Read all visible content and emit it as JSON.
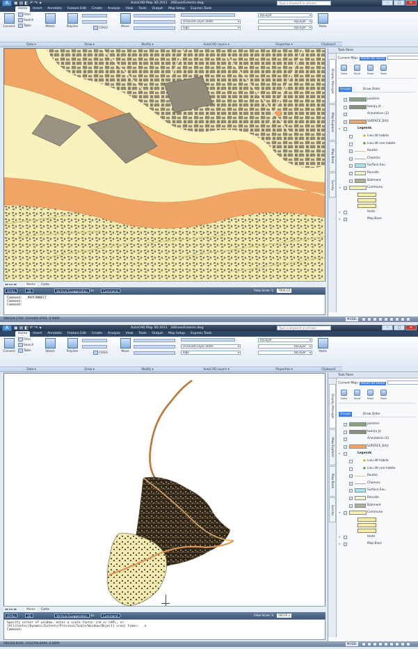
{
  "app": {
    "title": "AutoCAD Map 3D 2011",
    "drawing_name": "28ZoomExtents.dwg",
    "search_placeholder": "Type a keyword or phrase"
  },
  "ribbon": {
    "tabs": [
      "Home",
      "Insert",
      "Annotate",
      "Feature Edit",
      "Create",
      "Analyze",
      "View",
      "Tools",
      "Output",
      "Map Setup",
      "Express Tools"
    ],
    "active_tab": "Home",
    "data": {
      "connect": "Connect",
      "filter": "Filter",
      "search": "Search",
      "table": "Table",
      "attach": "Attach"
    },
    "draw": {
      "polyline": "Polyline",
      "cogo": "COGO"
    },
    "modify": {
      "move": "Move"
    },
    "autocad_layers": {
      "layer_state": "Unsaved Layer State",
      "layer": "logo"
    },
    "properties": {
      "color": "ByLayer",
      "linetype": "ByLayer",
      "lineweight": "ByLayer"
    },
    "clipboard": {
      "paste": "Paste"
    },
    "panels": [
      "Data ▾",
      "Draw ▾",
      "Modify ▾",
      "AutoCAD Layers ▾",
      "Properties ▾",
      "Clipboard"
    ]
  },
  "layout_tabs": [
    "Model",
    "Carte"
  ],
  "nav": {
    "ortho": "Ortho",
    "mode_2d": "2D",
    "vertical_exaggeration": "Vertical Exaggeration",
    "exaggeration_value": "1x",
    "command_label": "Command",
    "view_scale_label": "View Scale: 1:",
    "view_scale_top": "7904.03",
    "view_scale_bottom": "58535.2"
  },
  "command": {
    "top": [
      "Command:  _MAPCONNECT",
      "Command:",
      "Command:"
    ],
    "bottom": [
      "Specify corner of window, enter a scale factor (nX or nXP), or",
      "[All/Center/Dynamic/Extents/Previous/Scale/Window/Object] <real time>:  _e",
      "Command:"
    ]
  },
  "status": {
    "coord_top": "580329.2706, 2434465.8761, 0.0000",
    "coord_bottom": "580329.8292, 2434766.8094, 0.0000",
    "model": "MODEL"
  },
  "task_pane": {
    "title": "Task Pane",
    "current_map_label": "Current Map:",
    "current_map": "Hauts-de-Seine",
    "side_tabs": [
      "Display Manager",
      "Map Explorer",
      "Map Book",
      "Survey"
    ],
    "tools": [
      "Data",
      "Style",
      "Table",
      "Tools"
    ],
    "groups_label": "Groups",
    "draw_order_label": "Draw Order",
    "layers": [
      {
        "name": "pointers",
        "checked": true,
        "expand": "",
        "indent": 0,
        "swatch": "#8aa27e"
      },
      {
        "name": "Iwenja_tt",
        "checked": false,
        "expand": "",
        "indent": 0,
        "swatch": "#8a8e7b"
      },
      {
        "name": "Annotation (2)",
        "checked": true,
        "expand": "",
        "indent": 0,
        "swatch": "#ffffff"
      },
      {
        "name": "SURFACE_EAU",
        "checked": true,
        "expand": "",
        "indent": 0,
        "swatch": "#f0a567"
      },
      {
        "name": "Legends",
        "checked": false,
        "expand": "▸",
        "indent": 0,
        "swatch": "folder"
      },
      {
        "name": "Lieu dit habite",
        "checked": false,
        "expand": "",
        "indent": 1,
        "swatch": "dot-yellow"
      },
      {
        "name": "Lieu dit non-habite",
        "checked": false,
        "expand": "",
        "indent": 1,
        "swatch": "dot-green"
      },
      {
        "name": "Routes",
        "checked": true,
        "expand": "",
        "indent": 1,
        "swatch": "line-tan"
      },
      {
        "name": "Chemins",
        "checked": true,
        "expand": "",
        "indent": 1,
        "swatch": "line-grey"
      },
      {
        "name": "Surface Eau",
        "checked": true,
        "expand": "",
        "indent": 1,
        "swatch": "#a8e7f2"
      },
      {
        "name": "Parcelle",
        "checked": true,
        "expand": "",
        "indent": 1,
        "swatch": "#f6efc8"
      },
      {
        "name": "Batiment",
        "checked": true,
        "expand": "",
        "indent": 1,
        "swatch": "#b7ad90"
      },
      {
        "name": "Commune",
        "checked": true,
        "expand": "▾",
        "indent": 0,
        "swatch": "multi"
      },
      {
        "name": "texte",
        "checked": false,
        "expand": "▸",
        "indent": 0,
        "swatch": "none"
      },
      {
        "name": "Map Base",
        "checked": true,
        "expand": "▸",
        "indent": 0,
        "swatch": "none"
      }
    ]
  },
  "colors": {
    "river": "#f0a567",
    "land": "#f9f4bf",
    "buildings": "#8d877a",
    "roads": "#f7ecaf",
    "dark_city": "#2d2518",
    "accent": "#3d7edb"
  }
}
